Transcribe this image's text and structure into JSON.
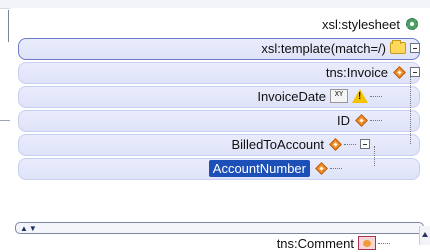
{
  "tree": {
    "stylesheet": {
      "label": "xsl:stylesheet",
      "icon": "gear-icon"
    },
    "template": {
      "label": "xsl:template(match=/)",
      "icons": [
        "folder-icon",
        "collapse-icon"
      ]
    },
    "invoice": {
      "label": "tns:Invoice",
      "icons": [
        "element-diamond-icon",
        "collapse-icon"
      ]
    },
    "invoice_date": {
      "label": "InvoiceDate",
      "icons": [
        "xyz-node-icon",
        "warning-icon"
      ]
    },
    "id": {
      "label": "ID",
      "icons": [
        "element-diamond-icon"
      ]
    },
    "billed_to_account": {
      "label": "BilledToAccount",
      "icons": [
        "element-diamond-icon",
        "collapse-icon"
      ]
    },
    "account_number": {
      "label": "AccountNumber",
      "icons": [
        "element-diamond-icon"
      ],
      "selected": true
    },
    "comment": {
      "label": "tns:Comment",
      "icons": [
        "comment-icon"
      ]
    }
  },
  "colors": {
    "band": "#e4e8fa",
    "selection": "#1d4fb8",
    "diamond": "#f28f2d"
  }
}
